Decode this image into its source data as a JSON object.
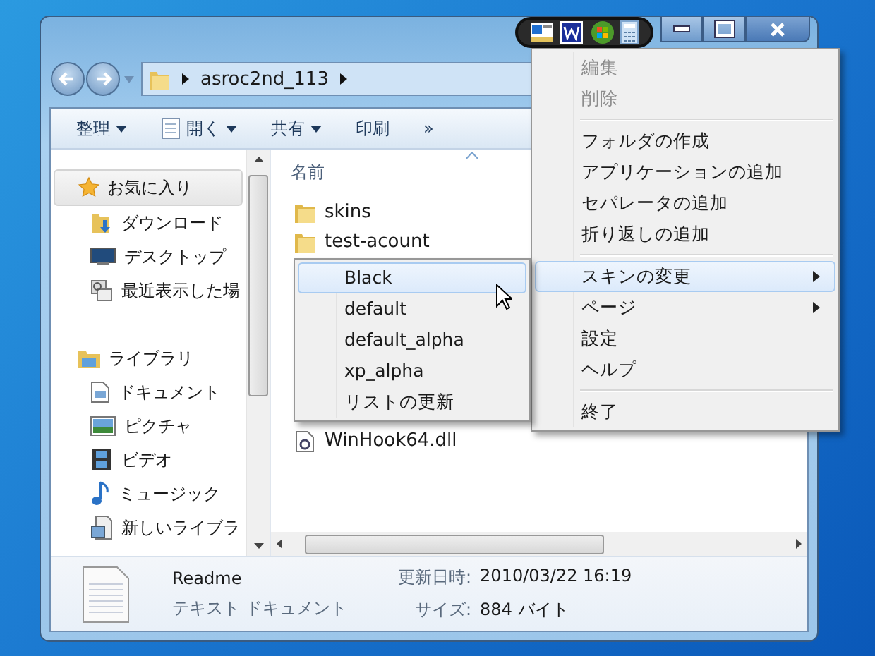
{
  "address_bar": {
    "path": "asroc2nd_113"
  },
  "command_bar": [
    {
      "label": "整理",
      "dropdown": true,
      "icon": false
    },
    {
      "label": "開く",
      "dropdown": true,
      "icon": true
    },
    {
      "label": "共有",
      "dropdown": true,
      "icon": false
    },
    {
      "label": "印刷",
      "dropdown": false,
      "icon": false
    },
    {
      "label": "»",
      "dropdown": false,
      "icon": false
    }
  ],
  "navigation": [
    {
      "label": "お気に入り",
      "kind": "favorites",
      "highlighted": true,
      "children": [
        {
          "label": "ダウンロード",
          "kind": "download"
        },
        {
          "label": "デスクトップ",
          "kind": "desktop"
        },
        {
          "label": "最近表示した場",
          "kind": "recent"
        }
      ]
    },
    {
      "label": "ライブラリ",
      "kind": "library",
      "highlighted": false,
      "children": [
        {
          "label": "ドキュメント",
          "kind": "document"
        },
        {
          "label": "ピクチャ",
          "kind": "picture"
        },
        {
          "label": "ビデオ",
          "kind": "video"
        },
        {
          "label": "ミュージック",
          "kind": "music"
        },
        {
          "label": "新しいライブラ",
          "kind": "newlib"
        }
      ]
    }
  ],
  "file_list": {
    "column": "名前",
    "items": [
      {
        "name": "skins",
        "kind": "folder"
      },
      {
        "name": "test-acount",
        "kind": "folder"
      },
      {
        "name": "WinHook64.dll",
        "kind": "dll"
      }
    ]
  },
  "details_pane": {
    "name": "Readme",
    "type": "テキスト ドキュメント",
    "fields": [
      {
        "label": "更新日時:",
        "value": "2010/03/22 16:19"
      },
      {
        "label": "サイズ:",
        "value": "884 バイト"
      }
    ]
  },
  "context_menu": [
    {
      "kind": "item",
      "label": "編集",
      "disabled": true,
      "selected": false,
      "submenu": false
    },
    {
      "kind": "item",
      "label": "削除",
      "disabled": true,
      "selected": false,
      "submenu": false
    },
    {
      "kind": "separator"
    },
    {
      "kind": "item",
      "label": "フォルダの作成",
      "disabled": false,
      "selected": false,
      "submenu": false
    },
    {
      "kind": "item",
      "label": "アプリケーションの追加",
      "disabled": false,
      "selected": false,
      "submenu": false
    },
    {
      "kind": "item",
      "label": "セパレータの追加",
      "disabled": false,
      "selected": false,
      "submenu": false
    },
    {
      "kind": "item",
      "label": "折り返しの追加",
      "disabled": false,
      "selected": false,
      "submenu": false
    },
    {
      "kind": "separator"
    },
    {
      "kind": "item",
      "label": "スキンの変更",
      "disabled": false,
      "selected": true,
      "submenu": true
    },
    {
      "kind": "item",
      "label": "ページ",
      "disabled": false,
      "selected": false,
      "submenu": true
    },
    {
      "kind": "item",
      "label": "設定",
      "disabled": false,
      "selected": false,
      "submenu": false
    },
    {
      "kind": "item",
      "label": "ヘルプ",
      "disabled": false,
      "selected": false,
      "submenu": false
    },
    {
      "kind": "separator"
    },
    {
      "kind": "item",
      "label": "終了",
      "disabled": false,
      "selected": false,
      "submenu": false
    }
  ],
  "skin_submenu": [
    {
      "label": "Black",
      "selected": true
    },
    {
      "label": "default",
      "selected": false
    },
    {
      "label": "default_alpha",
      "selected": false
    },
    {
      "label": "xp_alpha",
      "selected": false
    },
    {
      "label": "リストの更新",
      "selected": false
    }
  ]
}
